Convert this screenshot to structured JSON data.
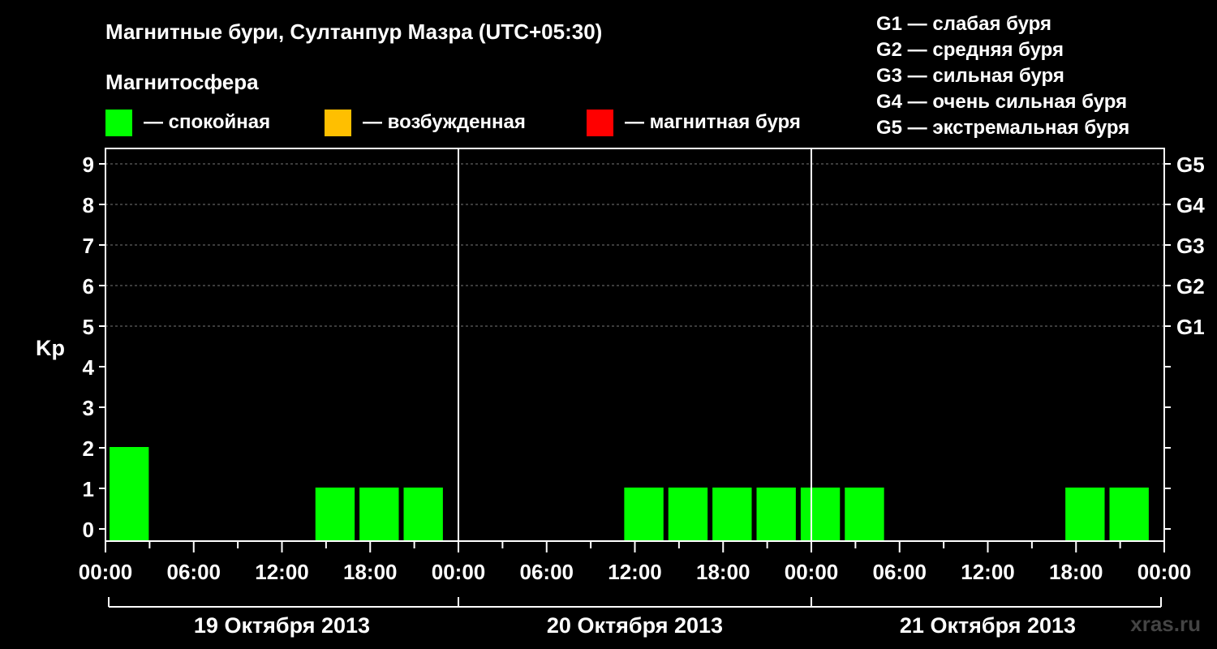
{
  "chart_data": {
    "type": "bar",
    "title": "Магнитные бури, Султанпур Мазра (UTC+05:30)",
    "subtitle": "Магнитосфера",
    "ylabel": "Kp",
    "ylim": [
      0,
      9
    ],
    "yticks": [
      "0",
      "1",
      "2",
      "3",
      "4",
      "5",
      "6",
      "7",
      "8",
      "9"
    ],
    "g_levels": [
      {
        "label": "G1",
        "kp": 5
      },
      {
        "label": "G2",
        "kp": 6
      },
      {
        "label": "G3",
        "kp": 7
      },
      {
        "label": "G4",
        "kp": 8
      },
      {
        "label": "G5",
        "kp": 9
      }
    ],
    "legend": [
      {
        "label": "— спокойная",
        "color": "#00ff00"
      },
      {
        "label": "— возбужденная",
        "color": "#ffbf00"
      },
      {
        "label": "— магнитная буря",
        "color": "#ff0000"
      }
    ],
    "g_legend": [
      "G1 — слабая буря",
      "G2 — средняя буря",
      "G3 — сильная буря",
      "G4 — очень сильная буря",
      "G5 — экстремальная буря"
    ],
    "x_start": "2013-10-19 00:00",
    "x_end": "2013-10-22 00:00",
    "xticks": [
      "00:00",
      "06:00",
      "12:00",
      "18:00",
      "00:00",
      "06:00",
      "12:00",
      "18:00",
      "00:00",
      "06:00",
      "12:00",
      "18:00",
      "00:00"
    ],
    "days": [
      "19 Октября 2013",
      "20 Октября 2013",
      "21 Октября 2013"
    ],
    "bars": [
      {
        "start": "2013-10-19 00:00",
        "kp": 2,
        "color": "#00ff00"
      },
      {
        "start": "2013-10-19 14:00",
        "kp": 1,
        "color": "#00ff00"
      },
      {
        "start": "2013-10-19 17:00",
        "kp": 1,
        "color": "#00ff00"
      },
      {
        "start": "2013-10-19 20:00",
        "kp": 1,
        "color": "#00ff00"
      },
      {
        "start": "2013-10-20 11:00",
        "kp": 1,
        "color": "#00ff00"
      },
      {
        "start": "2013-10-20 14:00",
        "kp": 1,
        "color": "#00ff00"
      },
      {
        "start": "2013-10-20 17:00",
        "kp": 1,
        "color": "#00ff00"
      },
      {
        "start": "2013-10-20 20:00",
        "kp": 1,
        "color": "#00ff00"
      },
      {
        "start": "2013-10-20 23:00",
        "kp": 1,
        "color": "#00ff00"
      },
      {
        "start": "2013-10-21 02:00",
        "kp": 1,
        "color": "#00ff00"
      },
      {
        "start": "2013-10-21 17:00",
        "kp": 1,
        "color": "#00ff00"
      },
      {
        "start": "2013-10-21 20:00",
        "kp": 1,
        "color": "#00ff00"
      }
    ],
    "grid": true,
    "legend_position": "top"
  },
  "watermark": "xras.ru"
}
